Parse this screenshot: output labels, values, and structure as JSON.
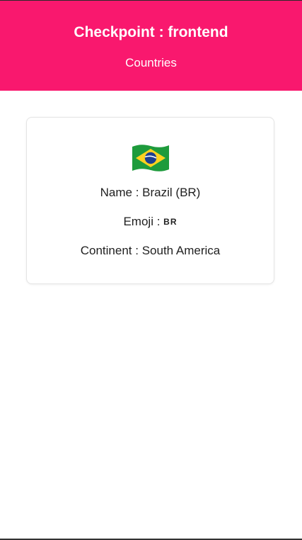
{
  "theme": {
    "header_color": "#f9186e"
  },
  "header": {
    "title": "Checkpoint : frontend",
    "subtitle": "Countries"
  },
  "country_card": {
    "flag_icon": "brazil-flag-emoji",
    "name_label": "Name :",
    "name_value": "Brazil (BR)",
    "emoji_label": "Emoji :",
    "emoji_value": "BR",
    "continent_label": "Continent :",
    "continent_value": "South America"
  }
}
